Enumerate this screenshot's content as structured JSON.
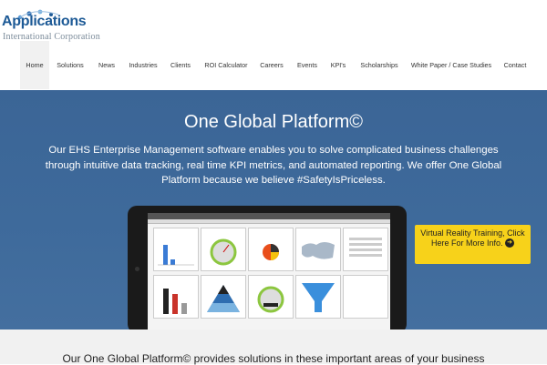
{
  "logo": {
    "name": "Applications",
    "sub": "International Corporation"
  },
  "nav": {
    "items": [
      {
        "label": "Home",
        "active": true
      },
      {
        "label": "Solutions"
      },
      {
        "label": "News"
      },
      {
        "label": "Industries"
      },
      {
        "label": "Clients"
      },
      {
        "label": "ROI Calculator"
      },
      {
        "label": "Careers"
      },
      {
        "label": "Events"
      },
      {
        "label": "KPI's"
      },
      {
        "label": "Scholarships"
      },
      {
        "label": "White Paper / Case Studies"
      },
      {
        "label": "Contact"
      }
    ]
  },
  "hero": {
    "title": "One Global Platform©",
    "text": "Our EHS Enterprise Management software enables you to solve complicated business challenges through intuitive data tracking, real time KPI metrics, and automated reporting. We offer One Global Platform because we believe #SafetyIsPriceless.",
    "vr_button": "Virtual Reality Training, Click Here For More Info.",
    "vr_icon": "arrow-circle-icon"
  },
  "bottom": {
    "text": "Our One Global Platform© provides solutions in these important areas of your business"
  },
  "colors": {
    "brand": "#1d5a96",
    "hero_bg": "#3e6a9b",
    "cta": "#f7d21a"
  }
}
